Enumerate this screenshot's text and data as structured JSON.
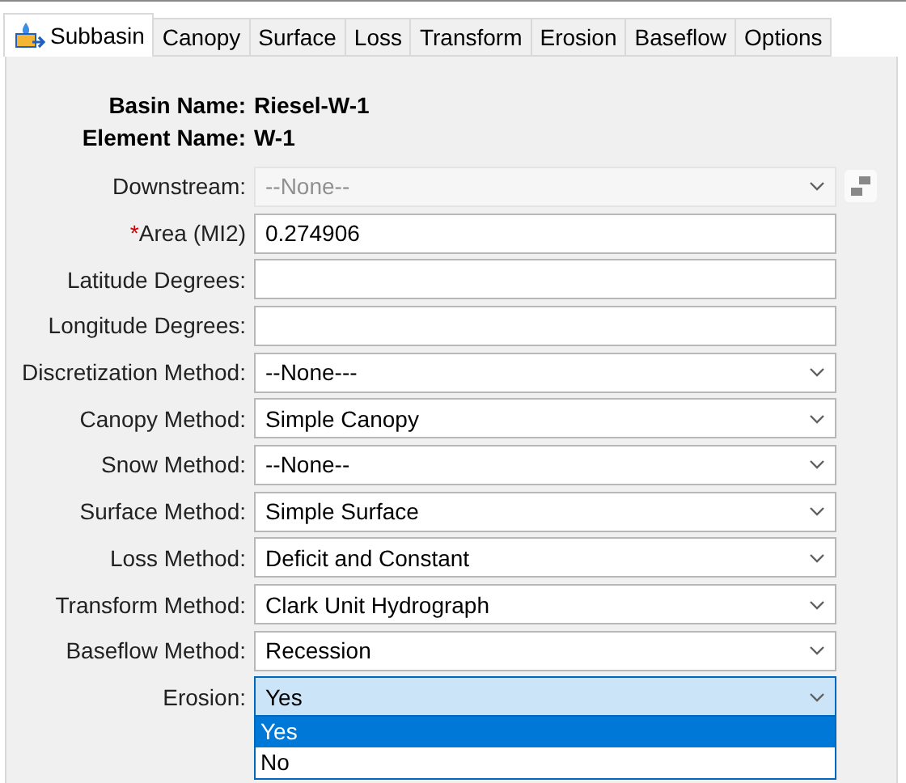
{
  "tabs": [
    {
      "label": "Subbasin",
      "selected": true,
      "icon": true
    },
    {
      "label": "Canopy",
      "selected": false
    },
    {
      "label": "Surface",
      "selected": false
    },
    {
      "label": "Loss",
      "selected": false
    },
    {
      "label": "Transform",
      "selected": false
    },
    {
      "label": "Erosion",
      "selected": false
    },
    {
      "label": "Baseflow",
      "selected": false
    },
    {
      "label": "Options",
      "selected": false
    }
  ],
  "info": [
    {
      "label": "Basin Name:",
      "value": "Riesel-W-1"
    },
    {
      "label": "Element Name:",
      "value": "W-1"
    }
  ],
  "fields": [
    {
      "kind": "select",
      "label": "Downstream:",
      "value": "--None--",
      "disabled": true,
      "side_button": true
    },
    {
      "kind": "text",
      "label": "Area (MI2)",
      "required": "*",
      "value": "0.274906"
    },
    {
      "kind": "text",
      "label": "Latitude Degrees:"
    },
    {
      "kind": "text",
      "label": "Longitude Degrees:"
    },
    {
      "kind": "select",
      "label": "Discretization Method:",
      "value": "--None---"
    },
    {
      "kind": "select",
      "label": "Canopy Method:",
      "value": "Simple Canopy"
    },
    {
      "kind": "select",
      "label": "Snow Method:",
      "value": "--None--"
    },
    {
      "kind": "select",
      "label": "Surface Method:",
      "value": "Simple Surface"
    },
    {
      "kind": "select",
      "label": "Loss Method:",
      "value": "Deficit and Constant"
    },
    {
      "kind": "select",
      "label": "Transform Method:",
      "value": "Clark Unit Hydrograph"
    },
    {
      "kind": "select",
      "label": "Baseflow Method:",
      "value": "Recession"
    },
    {
      "kind": "select",
      "label": "Erosion:",
      "value": "Yes",
      "expanded": true,
      "options": [
        {
          "label": "Yes",
          "selected": true
        },
        {
          "label": "No",
          "selected": false
        }
      ]
    }
  ]
}
